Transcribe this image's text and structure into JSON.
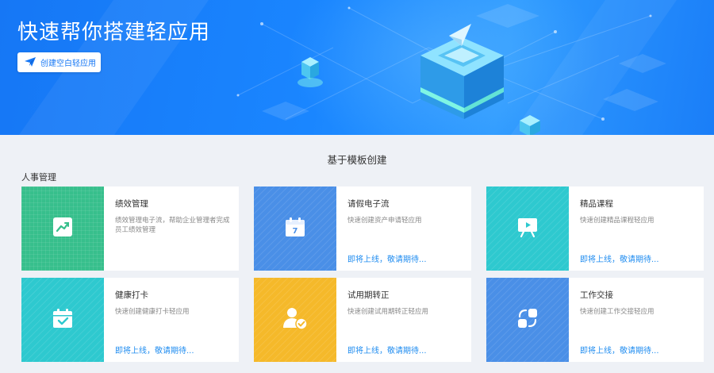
{
  "hero": {
    "title": "快速帮你搭建轻应用",
    "create_button": "创建空白轻应用"
  },
  "section_title": "基于模板创建",
  "group_title": "人事管理",
  "cards": [
    {
      "name": "绩效管理",
      "desc": "绩效管理电子流，帮助企业管理者完成员工绩效管理",
      "soon": "",
      "color": "#37bf8c",
      "icon": "chart-trend-icon"
    },
    {
      "name": "请假电子流",
      "desc": "快速创建资产申请轻应用",
      "soon": "即将上线，敬请期待...",
      "color": "#4a8fe7",
      "icon": "calendar-7-icon"
    },
    {
      "name": "精品课程",
      "desc": "快速创建精品课程轻应用",
      "soon": "即将上线，敬请期待...",
      "color": "#2ec9cf",
      "icon": "presentation-play-icon"
    },
    {
      "name": "健康打卡",
      "desc": "快速创建健康打卡轻应用",
      "soon": "即将上线，敬请期待...",
      "color": "#2ec9cf",
      "icon": "calendar-check-icon"
    },
    {
      "name": "试用期转正",
      "desc": "快速创建试用期转正轻应用",
      "soon": "即将上线，敬请期待...",
      "color": "#f5b92a",
      "icon": "user-check-icon"
    },
    {
      "name": "工作交接",
      "desc": "快速创建工作交接轻应用",
      "soon": "即将上线，敬请期待...",
      "color": "#4a8fe7",
      "icon": "handover-icon"
    }
  ]
}
